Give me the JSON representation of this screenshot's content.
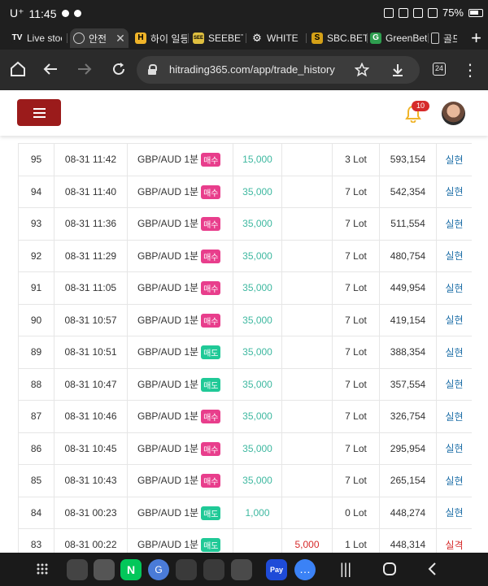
{
  "status_bar": {
    "carrier": "U⁺",
    "time": "11:45",
    "battery": "75%"
  },
  "tabs": [
    {
      "label": "Live stoc",
      "favicon": "TV"
    },
    {
      "label": "안전",
      "favicon": "globe"
    },
    {
      "label": "하이 일등",
      "favicon": "H"
    },
    {
      "label": "SEEBET-",
      "favicon": "SEE"
    },
    {
      "label": "WHITE",
      "favicon": "gear"
    },
    {
      "label": "SBC.BET",
      "favicon": "S"
    },
    {
      "label": "GreenBet",
      "favicon": "G"
    },
    {
      "label": "골드",
      "favicon": "doc"
    }
  ],
  "address_bar": {
    "url": "hitrading365.com/app/trade_history",
    "tab_count": "24"
  },
  "header": {
    "notification_count": "10"
  },
  "trades": [
    {
      "id": "95",
      "time": "08-31 11:42",
      "symbol": "GBP/AUD 1분",
      "side": "매수",
      "side_type": "buy",
      "amount": "15,000",
      "loss": "",
      "lot": "3 Lot",
      "balance": "593,154",
      "result": "실현"
    },
    {
      "id": "94",
      "time": "08-31 11:40",
      "symbol": "GBP/AUD 1분",
      "side": "매수",
      "side_type": "buy",
      "amount": "35,000",
      "loss": "",
      "lot": "7 Lot",
      "balance": "542,354",
      "result": "실현"
    },
    {
      "id": "93",
      "time": "08-31 11:36",
      "symbol": "GBP/AUD 1분",
      "side": "매수",
      "side_type": "buy",
      "amount": "35,000",
      "loss": "",
      "lot": "7 Lot",
      "balance": "511,554",
      "result": "실현"
    },
    {
      "id": "92",
      "time": "08-31 11:29",
      "symbol": "GBP/AUD 1분",
      "side": "매수",
      "side_type": "buy",
      "amount": "35,000",
      "loss": "",
      "lot": "7 Lot",
      "balance": "480,754",
      "result": "실현"
    },
    {
      "id": "91",
      "time": "08-31 11:05",
      "symbol": "GBP/AUD 1분",
      "side": "매수",
      "side_type": "buy",
      "amount": "35,000",
      "loss": "",
      "lot": "7 Lot",
      "balance": "449,954",
      "result": "실현"
    },
    {
      "id": "90",
      "time": "08-31 10:57",
      "symbol": "GBP/AUD 1분",
      "side": "매수",
      "side_type": "buy",
      "amount": "35,000",
      "loss": "",
      "lot": "7 Lot",
      "balance": "419,154",
      "result": "실현"
    },
    {
      "id": "89",
      "time": "08-31 10:51",
      "symbol": "GBP/AUD 1분",
      "side": "매도",
      "side_type": "sell",
      "amount": "35,000",
      "loss": "",
      "lot": "7 Lot",
      "balance": "388,354",
      "result": "실현"
    },
    {
      "id": "88",
      "time": "08-31 10:47",
      "symbol": "GBP/AUD 1분",
      "side": "매도",
      "side_type": "sell",
      "amount": "35,000",
      "loss": "",
      "lot": "7 Lot",
      "balance": "357,554",
      "result": "실현"
    },
    {
      "id": "87",
      "time": "08-31 10:46",
      "symbol": "GBP/AUD 1분",
      "side": "매수",
      "side_type": "buy",
      "amount": "35,000",
      "loss": "",
      "lot": "7 Lot",
      "balance": "326,754",
      "result": "실현"
    },
    {
      "id": "86",
      "time": "08-31 10:45",
      "symbol": "GBP/AUD 1분",
      "side": "매수",
      "side_type": "buy",
      "amount": "35,000",
      "loss": "",
      "lot": "7 Lot",
      "balance": "295,954",
      "result": "실현"
    },
    {
      "id": "85",
      "time": "08-31 10:43",
      "symbol": "GBP/AUD 1분",
      "side": "매수",
      "side_type": "buy",
      "amount": "35,000",
      "loss": "",
      "lot": "7 Lot",
      "balance": "265,154",
      "result": "실현"
    },
    {
      "id": "84",
      "time": "08-31 00:23",
      "symbol": "GBP/AUD 1분",
      "side": "매도",
      "side_type": "sell",
      "amount": "1,000",
      "loss": "",
      "lot": "0 Lot",
      "balance": "448,274",
      "result": "실현"
    },
    {
      "id": "83",
      "time": "08-31 00:22",
      "symbol": "GBP/AUD 1분",
      "side": "매도",
      "side_type": "sell",
      "amount": "",
      "loss": "5,000",
      "lot": "1 Lot",
      "balance": "448,314",
      "result": "실격"
    }
  ],
  "colors": {
    "buy": "#e83e8c",
    "sell": "#20c997",
    "amount": "#3eb8a0",
    "loss": "#d62b2b",
    "result": "#1e6fa8",
    "menu_button": "#9b1b1b"
  }
}
